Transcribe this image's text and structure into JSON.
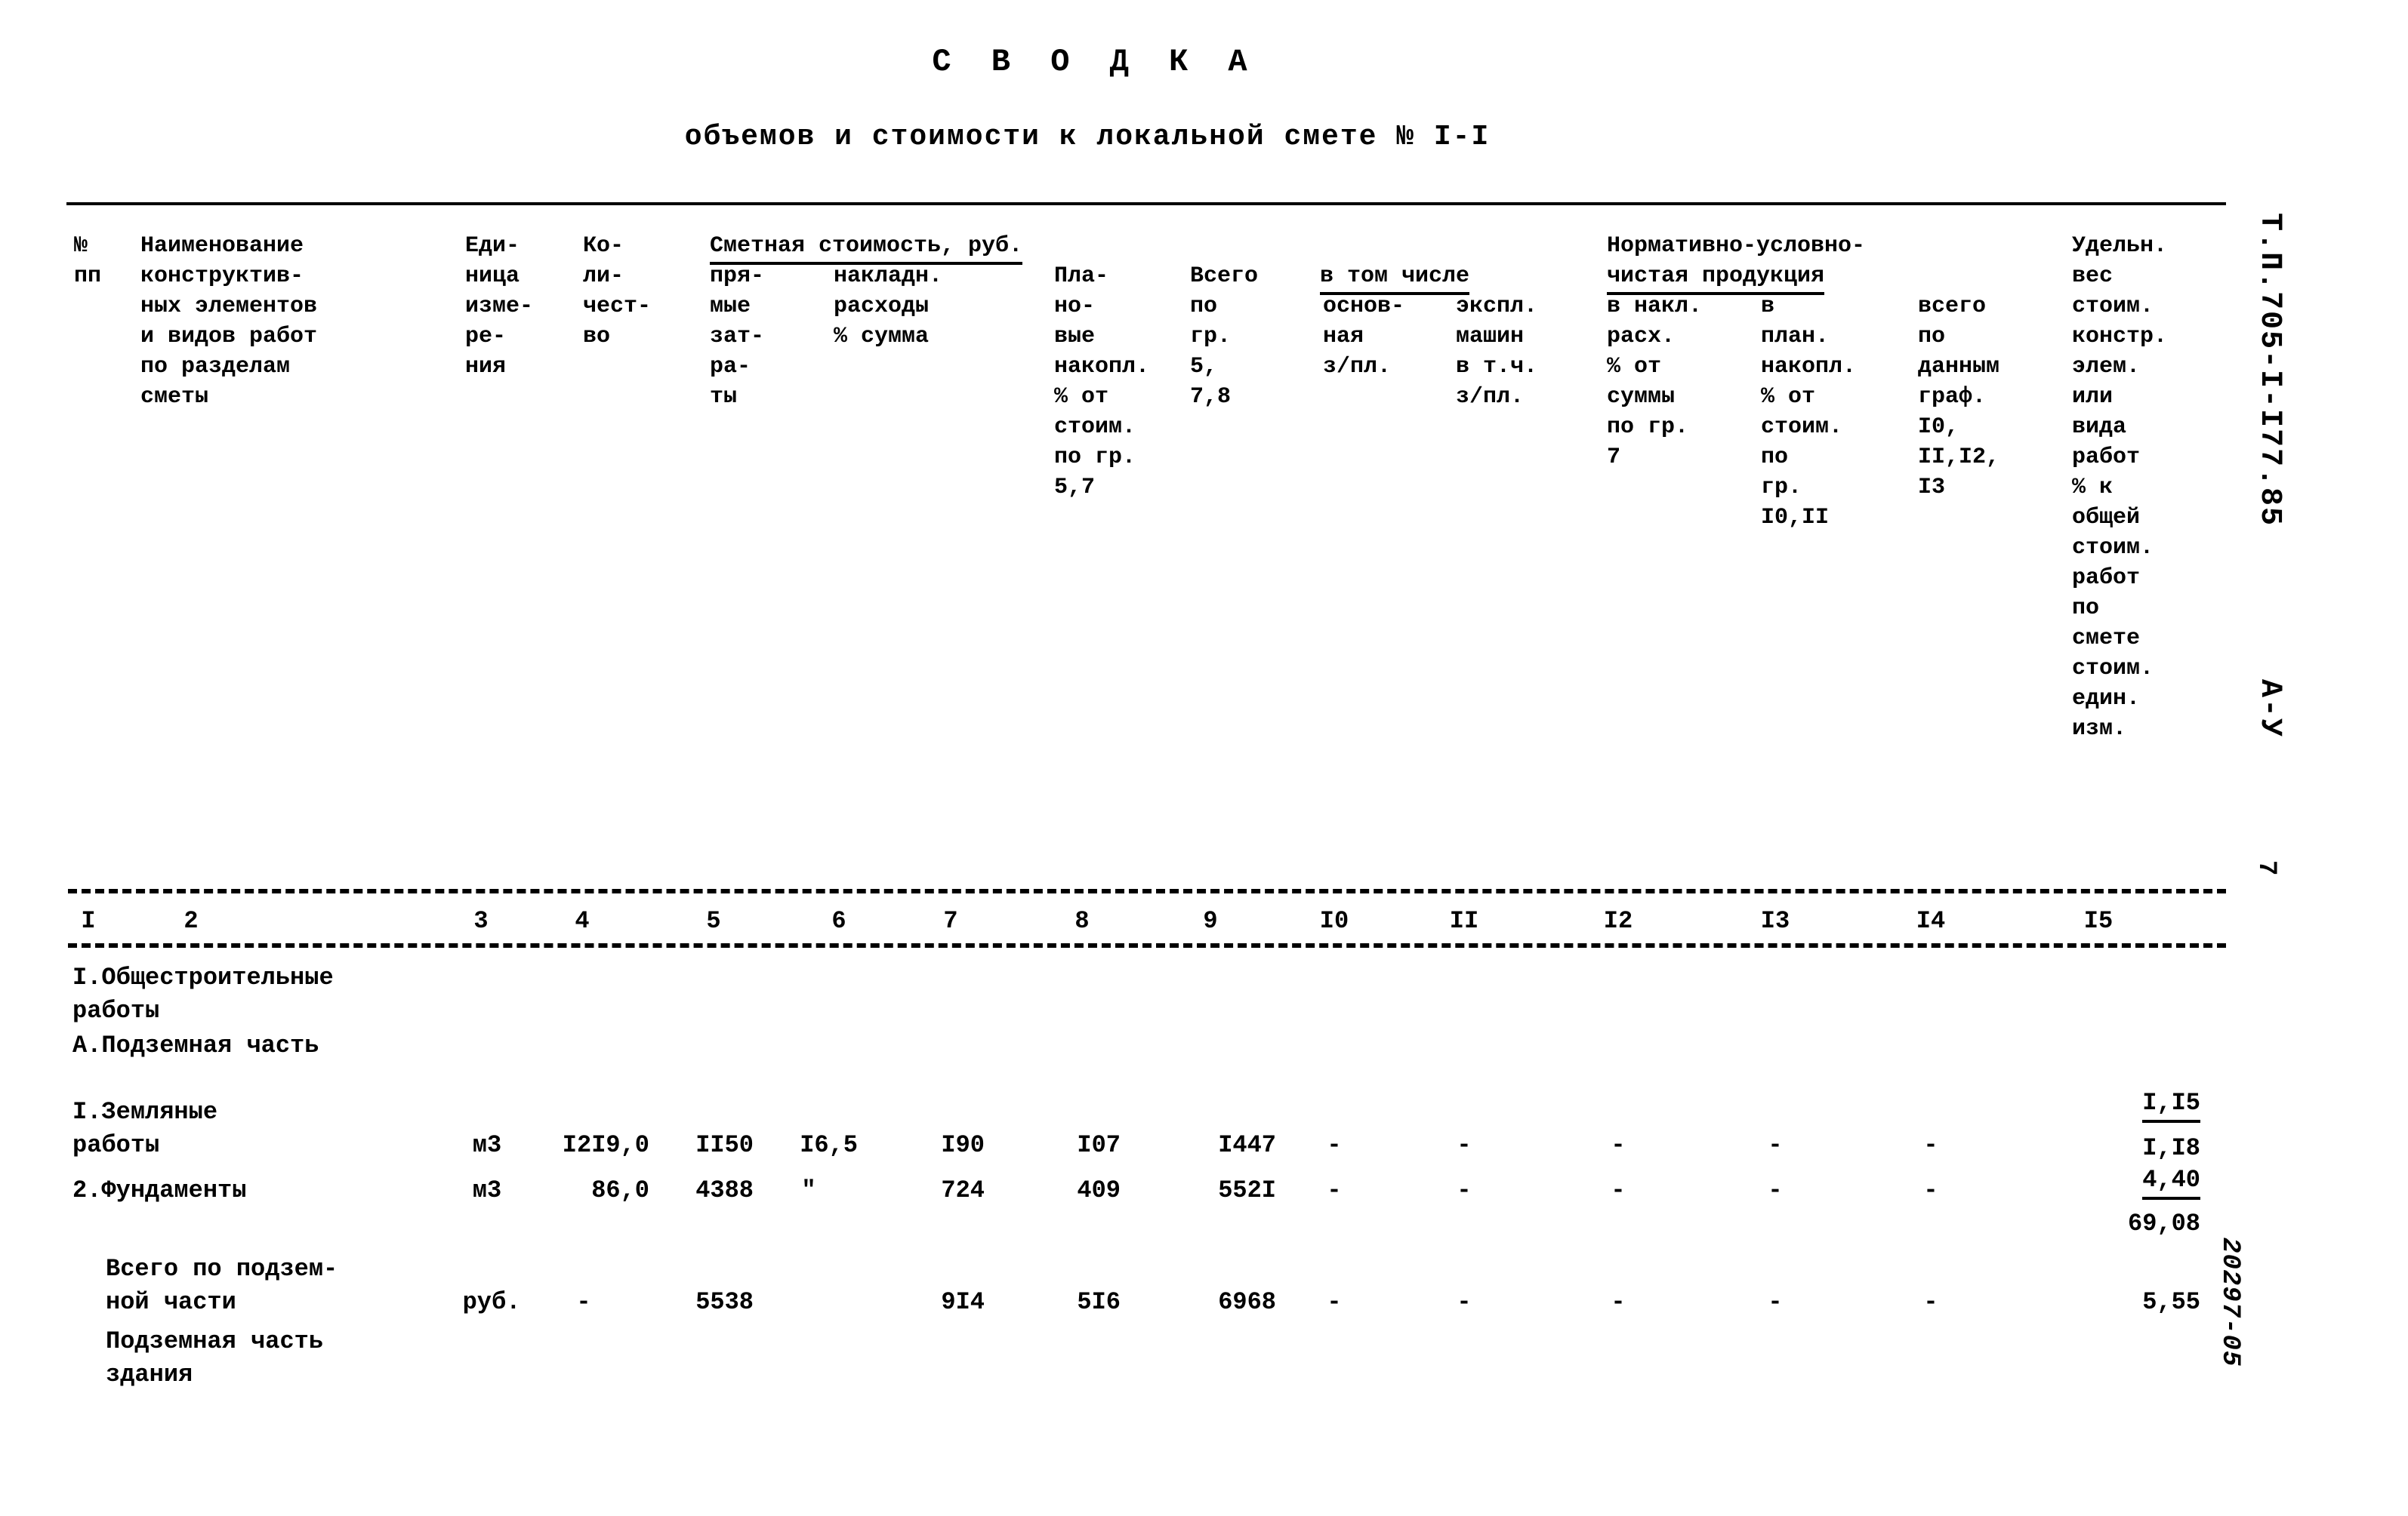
{
  "document": {
    "title": "С В О Д К А",
    "subtitle": "объемов и стоимости к локальной смете № I-I",
    "side_code": "Т.П.705-I-I77.85",
    "side_sheet": "А-У",
    "side_page_number": "7",
    "side_stamp": "20297-05"
  },
  "table": {
    "group_headers": [
      {
        "id": "smetnaya",
        "label": "Сметная стоимость, руб."
      },
      {
        "id": "v_tom_chisle",
        "label": "в том числе"
      },
      {
        "id": "nuchp_line1",
        "label": "Нормативно-условно-"
      },
      {
        "id": "nuchp_line2",
        "label": "чистая продукция"
      }
    ],
    "columns": [
      {
        "num": "I",
        "header": "№\nпп"
      },
      {
        "num": "2",
        "header": "Наименование\nконструктив-\nных элементов\nи видов работ\nпо разделам\nсметы"
      },
      {
        "num": "3",
        "header": "Еди-\nница\nизме-\nре-\nния"
      },
      {
        "num": "4",
        "header": "Ко-\nли-\nчест-\nво"
      },
      {
        "num": "5",
        "header": "пря-\nмые\nзат-\nра-\nты"
      },
      {
        "num": "6",
        "header": "накладн.\nрасходы\n%      сумма"
      },
      {
        "num": "7",
        "header": "Пла-\nно-\nвые\nнакопл.\n% от\nстоим.\nпо гр.\n5,7"
      },
      {
        "num": "8",
        "header": "Всего\nпо\nгр.\n5,\n7,8"
      },
      {
        "num": "9",
        "header": "основ-\nная\nз/пл."
      },
      {
        "num": "I0",
        "header": "экспл.\nмашин\nв т.ч.\nз/пл."
      },
      {
        "num": "II",
        "header": "в накл.\nрасх.\n% от\nсуммы\nпо гр.\n7"
      },
      {
        "num": "I2",
        "header": "в\nплан.\nнакопл.\n% от\nстоим.\nпо\nгр.\nI0,II"
      },
      {
        "num": "I3",
        "header": "всего\nпо\nданным\nграф.\nI0,\nII,I2,\nI3"
      },
      {
        "num": "I4",
        "header": ""
      },
      {
        "num": "I5",
        "header": "Удельн.\nвес\nстоим.\nконстр.\nэлем.\nили\nвида\nработ\n% к\nобщей\nстоим.\nработ\nпо\nсмете\nстоим.\nедин.\nизм."
      }
    ],
    "col_number_row": [
      "I",
      "2",
      "3",
      "4",
      "5",
      "6",
      "7",
      "8",
      "9",
      "I0",
      "II",
      "I2",
      "I3",
      "I4",
      "I5"
    ],
    "sections": [
      {
        "type": "section",
        "label": "I.Общестроительные\n     работы"
      },
      {
        "type": "section",
        "label": "А.Подземная часть"
      }
    ],
    "rows": [
      {
        "name": "I.Земляные\n   работы",
        "unit": "м3",
        "qty": "I2I9,0",
        "direct": "II50",
        "overhead_pct": "I6,5",
        "overhead_sum": "I90",
        "planned": "I07",
        "total": "I447",
        "basic_wage": "-",
        "machines": "-",
        "nuchp_overhead": "-",
        "nuchp_planned": "-",
        "nuchp_total": "-",
        "share_top": "I,I5",
        "share_bottom": "I,I8"
      },
      {
        "name": "2.Фундаменты",
        "unit": "м3",
        "qty": "86,0",
        "direct": "4388",
        "overhead_pct": "\"",
        "overhead_sum": "724",
        "planned": "409",
        "total": "552I",
        "basic_wage": "-",
        "machines": "-",
        "nuchp_overhead": "-",
        "nuchp_planned": "-",
        "nuchp_total": "-",
        "share_top": "4,40",
        "share_bottom": "69,08"
      },
      {
        "name": "Всего по подзем-\nной части",
        "unit": "руб.",
        "qty": "-",
        "direct": "5538",
        "overhead_pct": "",
        "overhead_sum": "9I4",
        "planned": "5I6",
        "total": "6968",
        "basic_wage": "-",
        "machines": "-",
        "nuchp_overhead": "-",
        "nuchp_planned": "-",
        "nuchp_total": "-",
        "share_top": "",
        "share_bottom": "5,55"
      }
    ],
    "footer_note": "Подземная часть\n      здания"
  }
}
